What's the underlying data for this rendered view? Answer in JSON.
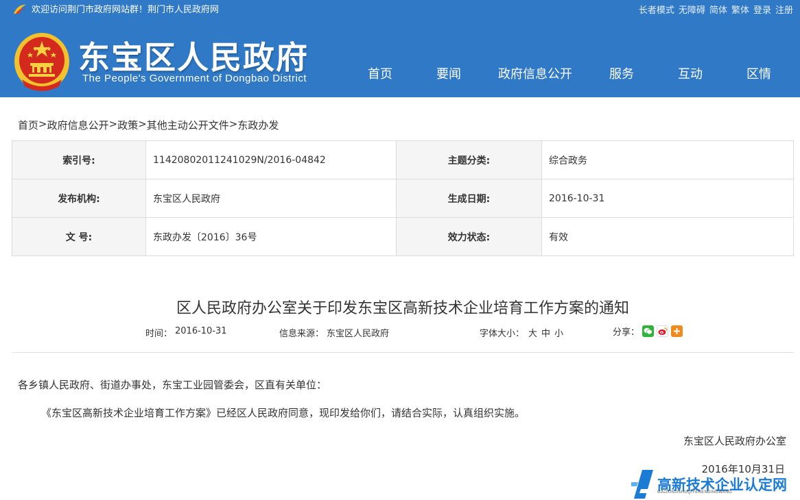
{
  "header": {
    "welcome_text": "欢迎访问荆门市政府网站群！荆门市人民政府网",
    "top_links": [
      "长者模式",
      "无障碍",
      "简体",
      "繁体",
      "登录",
      "注册"
    ],
    "site_title": "东宝区人民政府",
    "site_subtitle": "The People's Government of Dongbao District",
    "nav": [
      "首页",
      "要闻",
      "政府信息公开",
      "服务",
      "互动",
      "区情"
    ],
    "colors": {
      "header_bg": "#2f79c7"
    }
  },
  "breadcrumb": [
    "首页",
    ">",
    "政府信息公开",
    ">",
    "政策",
    ">",
    "其他主动公开文件",
    ">",
    "东政办发"
  ],
  "info": {
    "index_label": "索引号:",
    "index_value": "11420802011241029N/2016-04842",
    "topic_label": "主题分类:",
    "topic_value": "综合政务",
    "issuer_label": "发布机构:",
    "issuer_value": "东宝区人民政府",
    "date_label": "生成日期:",
    "date_value": "2016-10-31",
    "docno_label": "文 号:",
    "docno_value": "东政办发〔2016〕36号",
    "status_label": "效力状态:",
    "status_value": "有效"
  },
  "article": {
    "title": "区人民政府办公室关于印发东宝区高新技术企业培育工作方案的通知",
    "time_label": "时间：",
    "time_value": "2016-10-31",
    "source_label": "信息来源：",
    "source_value": "东宝区人民政府",
    "font_label": "字体大小：",
    "font_large": "大",
    "font_medium": "中",
    "font_small": "小",
    "share_label": "分享：",
    "greeting": "各乡镇人民政府、街道办事处，东宝工业园管委会，区直有关单位：",
    "body": "《东宝区高新技术企业培育工作方案》已经区人民政府同意，现印发给你们，请结合实际，认真组织实施。",
    "signer": "东宝区人民政府办公室",
    "sign_date": "2016年10月31日"
  },
  "watermark": {
    "main": "高新技术企业认定网",
    "sub": "GAOXINJISHUQIYERENDINGWANG"
  }
}
